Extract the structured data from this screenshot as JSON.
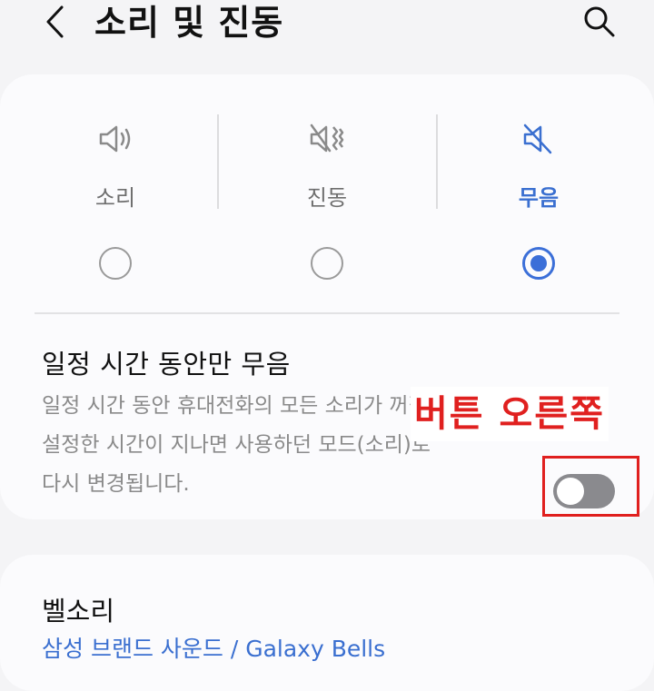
{
  "header": {
    "title": "소리 및 진동",
    "back_icon": "chevron-left-icon",
    "search_icon": "search-icon"
  },
  "sound_mode": {
    "options": [
      {
        "label": "소리",
        "icon": "speaker-icon",
        "selected": false
      },
      {
        "label": "진동",
        "icon": "vibrate-icon",
        "selected": false
      },
      {
        "label": "무음",
        "icon": "mute-icon",
        "selected": true
      }
    ],
    "accent_color": "#3b6fd8"
  },
  "mute_for_time": {
    "title": "일정 시간 동안만 무음",
    "description_lines": [
      "일정 시간 동안 휴대전화의 모든 소리가 꺼집니다.",
      "설정한 시간이 지나면 사용하던 모드(소리)로",
      "다시 변경됩니다."
    ],
    "toggle_on": false
  },
  "annotation": {
    "label": "버튼 오른쪽",
    "color": "#e0201f"
  },
  "ringtone": {
    "title": "벨소리",
    "value": "삼성 브랜드 사운드 / Galaxy Bells"
  }
}
